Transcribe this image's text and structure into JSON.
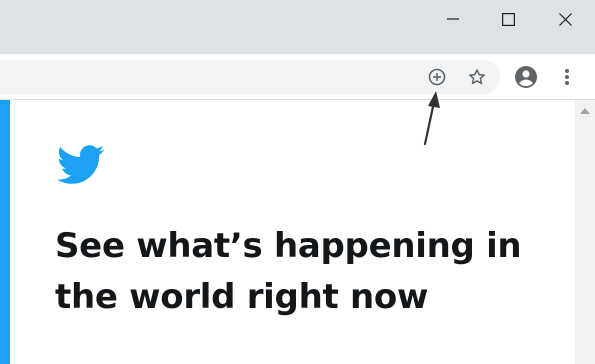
{
  "window": {
    "minimize_icon": "minimize-icon",
    "maximize_icon": "maximize-icon",
    "close_icon": "close-icon"
  },
  "toolbar": {
    "install_icon": "add-circle-icon",
    "bookmark_icon": "star-icon",
    "profile_icon": "account-circle-icon",
    "menu_icon": "more-vert-icon"
  },
  "page": {
    "brand_color": "#1da1f2",
    "logo_icon": "twitter-bird-icon",
    "headline_line1": "See what’s happening in",
    "headline_line2": "the world right now"
  },
  "annotation": {
    "arrow_icon": "pointer-arrow-icon"
  }
}
